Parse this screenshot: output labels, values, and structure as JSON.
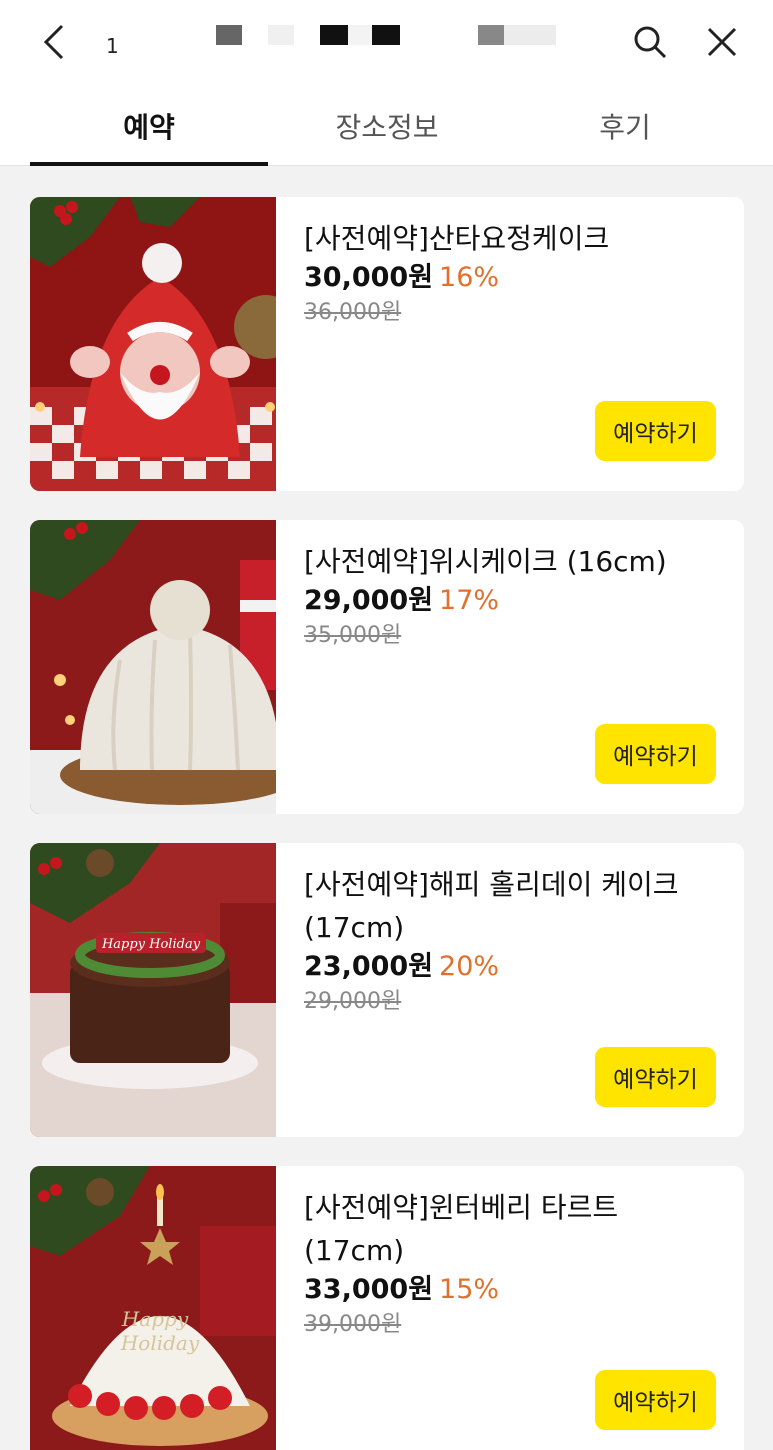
{
  "header": {
    "title_prefix": "1",
    "back_icon": "chevron-left-icon",
    "search_icon": "search-icon",
    "close_icon": "close-icon"
  },
  "tabs": [
    {
      "label": "예약",
      "active": true
    },
    {
      "label": "장소정보",
      "active": false
    },
    {
      "label": "후기",
      "active": false
    }
  ],
  "products": [
    {
      "name": "[사전예약]산타요정케이크",
      "price": "30,000원",
      "discount": "16%",
      "original_price": "36,000원",
      "button": "예약하기"
    },
    {
      "name": "[사전예약]위시케이크 (16cm)",
      "price": "29,000원",
      "discount": "17%",
      "original_price": "35,000원",
      "button": "예약하기"
    },
    {
      "name": "[사전예약]해피 홀리데이 케이크 (17cm)",
      "price": "23,000원",
      "discount": "20%",
      "original_price": "29,000원",
      "button": "예약하기"
    },
    {
      "name": "[사전예약]윈터베리 타르트 (17cm)",
      "price": "33,000원",
      "discount": "15%",
      "original_price": "39,000원",
      "button": "예약하기"
    }
  ],
  "colors": {
    "accent_yellow": "#ffe400",
    "discount_orange": "#e0702c"
  }
}
